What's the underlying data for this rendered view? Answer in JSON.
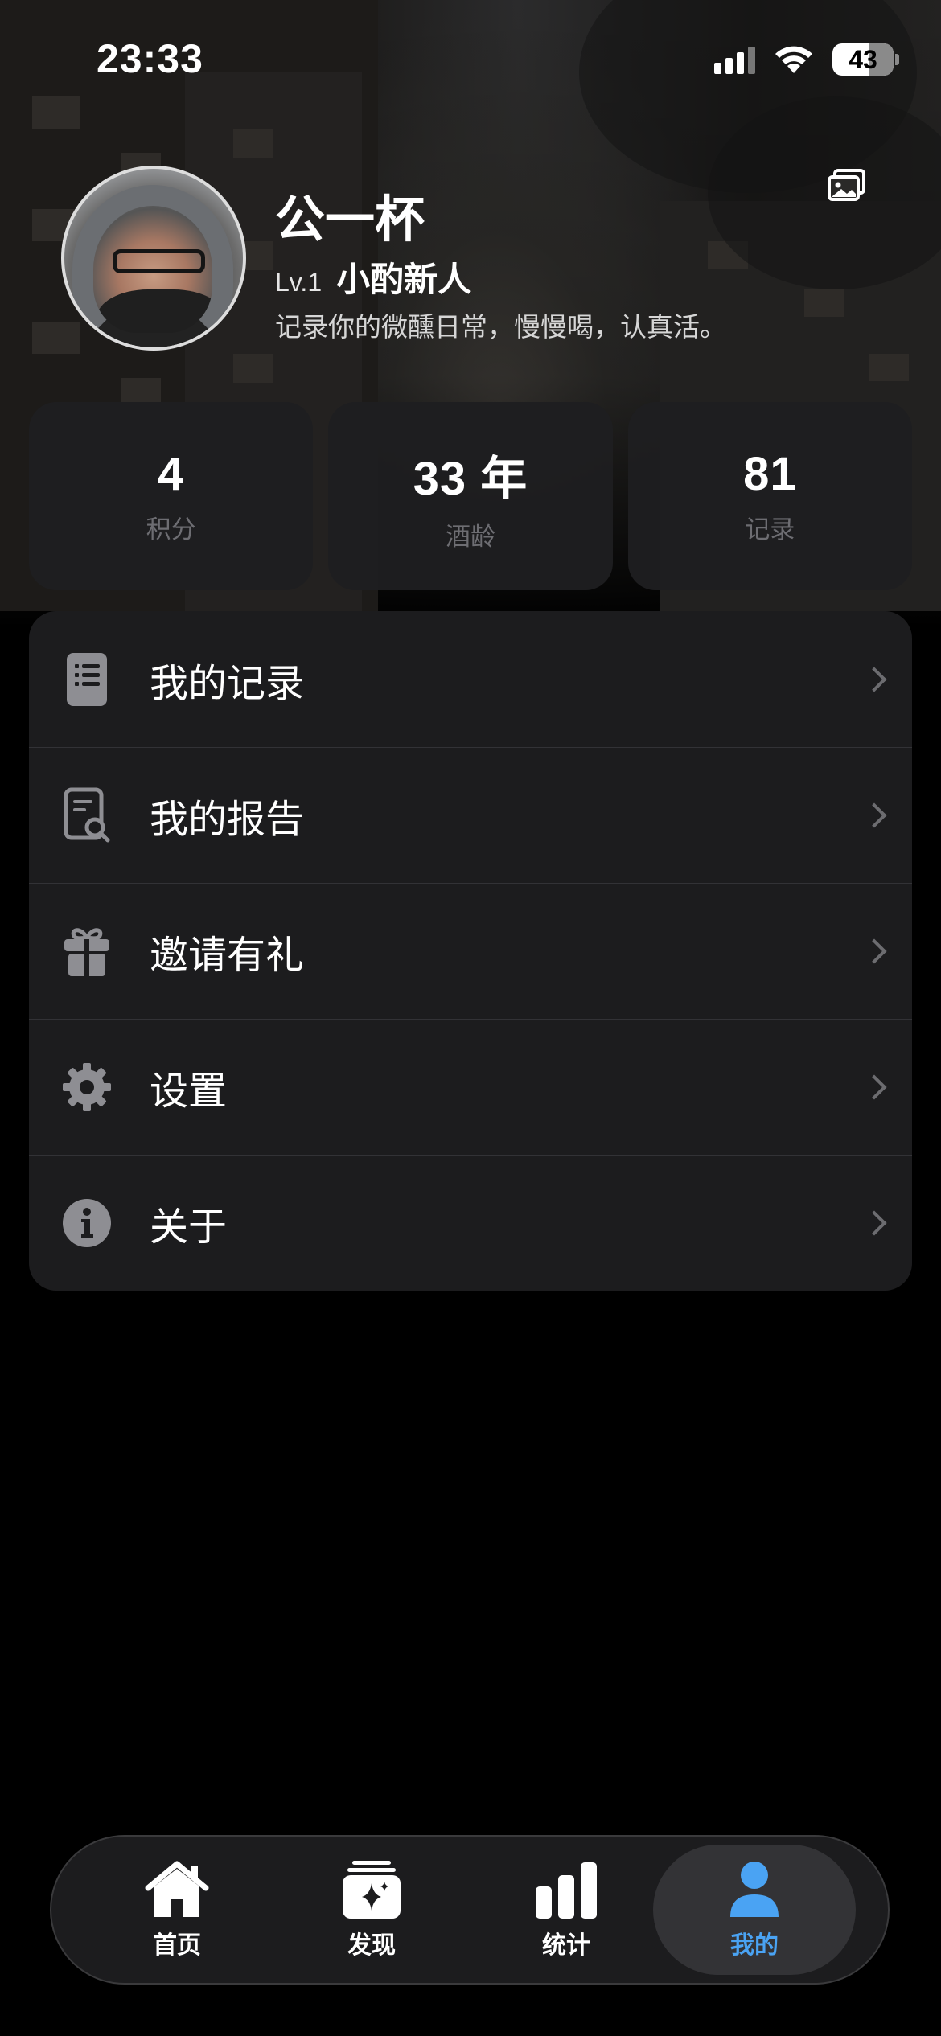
{
  "status_bar": {
    "time": "23:33",
    "battery": "43",
    "icons": [
      "cellular-signal-icon",
      "wifi-icon",
      "battery-icon"
    ]
  },
  "profile": {
    "name": "公一杯",
    "level": "Lv.1",
    "level_title": "小酌新人",
    "bio": "记录你的微醺日常，慢慢喝，认真活。"
  },
  "stats": [
    {
      "value": "4",
      "label": "积分"
    },
    {
      "value": "33 年",
      "label": "酒龄"
    },
    {
      "value": "81",
      "label": "记录"
    }
  ],
  "menu": [
    {
      "label": "我的记录",
      "icon": "list-document-icon"
    },
    {
      "label": "我的报告",
      "icon": "report-search-icon"
    },
    {
      "label": "邀请有礼",
      "icon": "gift-icon"
    },
    {
      "label": "设置",
      "icon": "gear-icon"
    },
    {
      "label": "关于",
      "icon": "info-icon"
    }
  ],
  "tabs": [
    {
      "label": "首页",
      "icon": "home-icon",
      "active": false
    },
    {
      "label": "发现",
      "icon": "discover-sparkle-icon",
      "active": false
    },
    {
      "label": "统计",
      "icon": "bar-chart-icon",
      "active": false
    },
    {
      "label": "我的",
      "icon": "person-icon",
      "active": true
    }
  ],
  "colors": {
    "background": "#000000",
    "card": "#1c1c1e",
    "secondary_text": "#6d6d72",
    "accent": "#4aa3f3",
    "icon_gray": "#8e8e93"
  }
}
